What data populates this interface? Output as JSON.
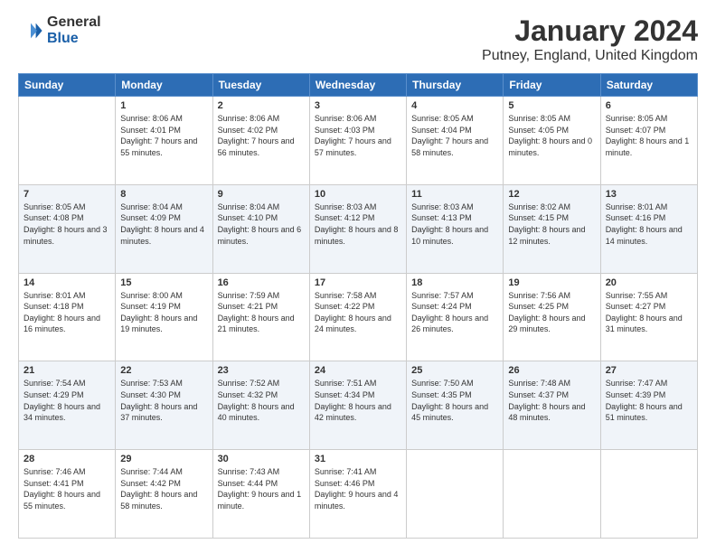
{
  "header": {
    "logo_line1": "General",
    "logo_line2": "Blue",
    "month": "January 2024",
    "location": "Putney, England, United Kingdom"
  },
  "weekdays": [
    "Sunday",
    "Monday",
    "Tuesday",
    "Wednesday",
    "Thursday",
    "Friday",
    "Saturday"
  ],
  "weeks": [
    [
      {
        "day": "",
        "sunrise": "",
        "sunset": "",
        "daylight": ""
      },
      {
        "day": "1",
        "sunrise": "Sunrise: 8:06 AM",
        "sunset": "Sunset: 4:01 PM",
        "daylight": "Daylight: 7 hours and 55 minutes."
      },
      {
        "day": "2",
        "sunrise": "Sunrise: 8:06 AM",
        "sunset": "Sunset: 4:02 PM",
        "daylight": "Daylight: 7 hours and 56 minutes."
      },
      {
        "day": "3",
        "sunrise": "Sunrise: 8:06 AM",
        "sunset": "Sunset: 4:03 PM",
        "daylight": "Daylight: 7 hours and 57 minutes."
      },
      {
        "day": "4",
        "sunrise": "Sunrise: 8:05 AM",
        "sunset": "Sunset: 4:04 PM",
        "daylight": "Daylight: 7 hours and 58 minutes."
      },
      {
        "day": "5",
        "sunrise": "Sunrise: 8:05 AM",
        "sunset": "Sunset: 4:05 PM",
        "daylight": "Daylight: 8 hours and 0 minutes."
      },
      {
        "day": "6",
        "sunrise": "Sunrise: 8:05 AM",
        "sunset": "Sunset: 4:07 PM",
        "daylight": "Daylight: 8 hours and 1 minute."
      }
    ],
    [
      {
        "day": "7",
        "sunrise": "Sunrise: 8:05 AM",
        "sunset": "Sunset: 4:08 PM",
        "daylight": "Daylight: 8 hours and 3 minutes."
      },
      {
        "day": "8",
        "sunrise": "Sunrise: 8:04 AM",
        "sunset": "Sunset: 4:09 PM",
        "daylight": "Daylight: 8 hours and 4 minutes."
      },
      {
        "day": "9",
        "sunrise": "Sunrise: 8:04 AM",
        "sunset": "Sunset: 4:10 PM",
        "daylight": "Daylight: 8 hours and 6 minutes."
      },
      {
        "day": "10",
        "sunrise": "Sunrise: 8:03 AM",
        "sunset": "Sunset: 4:12 PM",
        "daylight": "Daylight: 8 hours and 8 minutes."
      },
      {
        "day": "11",
        "sunrise": "Sunrise: 8:03 AM",
        "sunset": "Sunset: 4:13 PM",
        "daylight": "Daylight: 8 hours and 10 minutes."
      },
      {
        "day": "12",
        "sunrise": "Sunrise: 8:02 AM",
        "sunset": "Sunset: 4:15 PM",
        "daylight": "Daylight: 8 hours and 12 minutes."
      },
      {
        "day": "13",
        "sunrise": "Sunrise: 8:01 AM",
        "sunset": "Sunset: 4:16 PM",
        "daylight": "Daylight: 8 hours and 14 minutes."
      }
    ],
    [
      {
        "day": "14",
        "sunrise": "Sunrise: 8:01 AM",
        "sunset": "Sunset: 4:18 PM",
        "daylight": "Daylight: 8 hours and 16 minutes."
      },
      {
        "day": "15",
        "sunrise": "Sunrise: 8:00 AM",
        "sunset": "Sunset: 4:19 PM",
        "daylight": "Daylight: 8 hours and 19 minutes."
      },
      {
        "day": "16",
        "sunrise": "Sunrise: 7:59 AM",
        "sunset": "Sunset: 4:21 PM",
        "daylight": "Daylight: 8 hours and 21 minutes."
      },
      {
        "day": "17",
        "sunrise": "Sunrise: 7:58 AM",
        "sunset": "Sunset: 4:22 PM",
        "daylight": "Daylight: 8 hours and 24 minutes."
      },
      {
        "day": "18",
        "sunrise": "Sunrise: 7:57 AM",
        "sunset": "Sunset: 4:24 PM",
        "daylight": "Daylight: 8 hours and 26 minutes."
      },
      {
        "day": "19",
        "sunrise": "Sunrise: 7:56 AM",
        "sunset": "Sunset: 4:25 PM",
        "daylight": "Daylight: 8 hours and 29 minutes."
      },
      {
        "day": "20",
        "sunrise": "Sunrise: 7:55 AM",
        "sunset": "Sunset: 4:27 PM",
        "daylight": "Daylight: 8 hours and 31 minutes."
      }
    ],
    [
      {
        "day": "21",
        "sunrise": "Sunrise: 7:54 AM",
        "sunset": "Sunset: 4:29 PM",
        "daylight": "Daylight: 8 hours and 34 minutes."
      },
      {
        "day": "22",
        "sunrise": "Sunrise: 7:53 AM",
        "sunset": "Sunset: 4:30 PM",
        "daylight": "Daylight: 8 hours and 37 minutes."
      },
      {
        "day": "23",
        "sunrise": "Sunrise: 7:52 AM",
        "sunset": "Sunset: 4:32 PM",
        "daylight": "Daylight: 8 hours and 40 minutes."
      },
      {
        "day": "24",
        "sunrise": "Sunrise: 7:51 AM",
        "sunset": "Sunset: 4:34 PM",
        "daylight": "Daylight: 8 hours and 42 minutes."
      },
      {
        "day": "25",
        "sunrise": "Sunrise: 7:50 AM",
        "sunset": "Sunset: 4:35 PM",
        "daylight": "Daylight: 8 hours and 45 minutes."
      },
      {
        "day": "26",
        "sunrise": "Sunrise: 7:48 AM",
        "sunset": "Sunset: 4:37 PM",
        "daylight": "Daylight: 8 hours and 48 minutes."
      },
      {
        "day": "27",
        "sunrise": "Sunrise: 7:47 AM",
        "sunset": "Sunset: 4:39 PM",
        "daylight": "Daylight: 8 hours and 51 minutes."
      }
    ],
    [
      {
        "day": "28",
        "sunrise": "Sunrise: 7:46 AM",
        "sunset": "Sunset: 4:41 PM",
        "daylight": "Daylight: 8 hours and 55 minutes."
      },
      {
        "day": "29",
        "sunrise": "Sunrise: 7:44 AM",
        "sunset": "Sunset: 4:42 PM",
        "daylight": "Daylight: 8 hours and 58 minutes."
      },
      {
        "day": "30",
        "sunrise": "Sunrise: 7:43 AM",
        "sunset": "Sunset: 4:44 PM",
        "daylight": "Daylight: 9 hours and 1 minute."
      },
      {
        "day": "31",
        "sunrise": "Sunrise: 7:41 AM",
        "sunset": "Sunset: 4:46 PM",
        "daylight": "Daylight: 9 hours and 4 minutes."
      },
      {
        "day": "",
        "sunrise": "",
        "sunset": "",
        "daylight": ""
      },
      {
        "day": "",
        "sunrise": "",
        "sunset": "",
        "daylight": ""
      },
      {
        "day": "",
        "sunrise": "",
        "sunset": "",
        "daylight": ""
      }
    ]
  ]
}
